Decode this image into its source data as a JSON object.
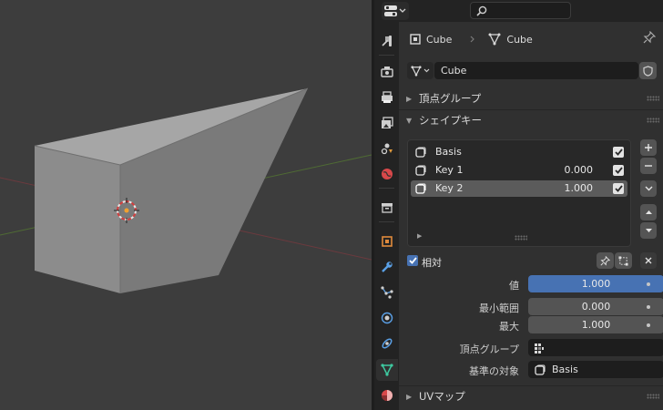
{
  "header": {
    "editor_type_icon": "properties-editor-icon",
    "search_icon": "search-icon"
  },
  "tabs": [
    {
      "name": "tool",
      "icon": "tool-icon"
    },
    {
      "name": "render",
      "icon": "render-icon"
    },
    {
      "name": "output",
      "icon": "output-icon"
    },
    {
      "name": "view-layer",
      "icon": "view-layer-icon"
    },
    {
      "name": "scene",
      "icon": "scene-icon"
    },
    {
      "name": "world",
      "icon": "world-icon"
    },
    {
      "name": "collection",
      "icon": "collection-icon"
    },
    {
      "name": "object",
      "icon": "object-icon"
    },
    {
      "name": "modifiers",
      "icon": "wrench-icon"
    },
    {
      "name": "particles",
      "icon": "particles-icon"
    },
    {
      "name": "physics",
      "icon": "physics-icon"
    },
    {
      "name": "constraints",
      "icon": "constraints-icon"
    },
    {
      "name": "data",
      "icon": "mesh-data-icon",
      "active": true
    },
    {
      "name": "material",
      "icon": "material-icon"
    }
  ],
  "breadcrumb": {
    "object_name": "Cube",
    "mesh_name": "Cube"
  },
  "datablock": {
    "name": "Cube"
  },
  "panels": {
    "vertex_groups": "頂点グループ",
    "shape_keys": "シェイプキー",
    "uv_maps": "UVマップ"
  },
  "shape_keys": [
    {
      "name": "Basis",
      "value": "",
      "checked": true,
      "active": false
    },
    {
      "name": "Key 1",
      "value": "0.000",
      "checked": true,
      "active": false
    },
    {
      "name": "Key 2",
      "value": "1.000",
      "checked": true,
      "active": true
    }
  ],
  "relative": {
    "label": "相対",
    "checked": true
  },
  "properties": {
    "value_label": "値",
    "value": "1.000",
    "value_fraction": 1.0,
    "range_min_label": "最小範囲",
    "range_min": "0.000",
    "max_label": "最大",
    "max": "1.000",
    "vertex_group_label": "頂点グループ",
    "vertex_group": "",
    "relative_to_label": "基準の対象",
    "relative_to": "Basis"
  },
  "colors": {
    "accent": "#4772b3",
    "active_tab_icon": "#3ec9a0",
    "viewport_bg": "#3d3d3d",
    "x_axis": "#c0474f",
    "y_axis": "#6e9a3a"
  }
}
